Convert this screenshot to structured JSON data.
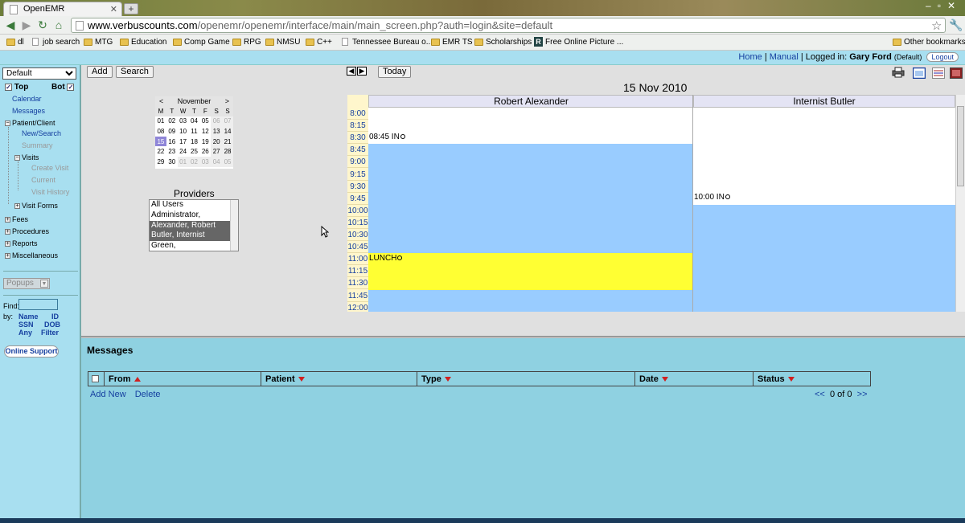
{
  "browser": {
    "tab_title": "OpenEMR",
    "url_host": "www.verbuscounts.com",
    "url_path": "/openemr/openemr/interface/main/main_screen.php?auth=login&site=default",
    "bookmarks": [
      {
        "label": "dl",
        "icon": "folder"
      },
      {
        "label": "job search",
        "icon": "page"
      },
      {
        "label": "MTG",
        "icon": "folder"
      },
      {
        "label": "Education",
        "icon": "folder"
      },
      {
        "label": "Comp Game",
        "icon": "folder"
      },
      {
        "label": "RPG",
        "icon": "folder"
      },
      {
        "label": "NMSU",
        "icon": "folder"
      },
      {
        "label": "C++",
        "icon": "folder"
      },
      {
        "label": "Tennessee Bureau o...",
        "icon": "page"
      },
      {
        "label": "EMR TS",
        "icon": "folder"
      },
      {
        "label": "Scholarships",
        "icon": "folder"
      },
      {
        "label": "Free Online Picture ...",
        "icon": "r"
      }
    ],
    "other_bookmarks": "Other bookmarks"
  },
  "header": {
    "home": "Home",
    "sep1": "|",
    "manual": "Manual",
    "sep2": "|",
    "logged_in_label": "Logged in:",
    "user": "Gary Ford",
    "user_group": "(Default)",
    "logout": "Logout"
  },
  "leftnav": {
    "facility_select": "Default",
    "top_label": "Top",
    "bot_label": "Bot",
    "calendar": "Calendar",
    "messages": "Messages",
    "patient_client": "Patient/Client",
    "new_search": "New/Search",
    "summary": "Summary",
    "visits": "Visits",
    "create_visit": "Create Visit",
    "current": "Current",
    "visit_history": "Visit History",
    "visit_forms": "Visit Forms",
    "fees": "Fees",
    "procedures": "Procedures",
    "reports": "Reports",
    "miscellaneous": "Miscellaneous",
    "popups": "Popups",
    "find_label": "Find:",
    "by_label": "by:",
    "find_opts": {
      "name": "Name",
      "id": "ID",
      "ssn": "SSN",
      "dob": "DOB",
      "any": "Any",
      "filter": "Filter"
    },
    "online_support": "Online Support"
  },
  "calendar": {
    "add": "Add",
    "search": "Search",
    "today": "Today",
    "date_title": "15 Nov 2010",
    "mini": {
      "prev": "<",
      "month": "November",
      "next": ">",
      "dow": [
        "M",
        "T",
        "W",
        "T",
        "F",
        "S",
        "S"
      ],
      "weeks": [
        [
          "01",
          "02",
          "03",
          "04",
          "05",
          "06",
          "07"
        ],
        [
          "08",
          "09",
          "10",
          "11",
          "12",
          "13",
          "14"
        ],
        [
          "15",
          "16",
          "17",
          "18",
          "19",
          "20",
          "21"
        ],
        [
          "22",
          "23",
          "24",
          "25",
          "26",
          "27",
          "28"
        ],
        [
          "29",
          "30",
          "01",
          "02",
          "03",
          "04",
          "05"
        ]
      ],
      "today": "15"
    },
    "providers_title": "Providers",
    "providers": [
      "All Users",
      "Administrator,",
      "Alexander, Robert",
      "Butler, Internist",
      "Green,"
    ],
    "providers_selected": [
      2,
      3
    ],
    "columns": [
      "Robert Alexander",
      "Internist Butler"
    ],
    "times": [
      "8:00",
      "8:15",
      "8:30",
      "8:45",
      "9:00",
      "9:15",
      "9:30",
      "9:45",
      "10:00",
      "10:15",
      "10:30",
      "10:45",
      "11:00",
      "11:15",
      "11:30",
      "11:45",
      "12:00"
    ],
    "events": {
      "a_in": "08:45 IN",
      "a_lunch": "LUNCH",
      "b_in": "10:00 IN"
    },
    "colors": {
      "available": "#99ccff",
      "lunch": "#ffff33",
      "free": "#ffffff"
    }
  },
  "messages": {
    "title": "Messages",
    "columns": [
      "From",
      "Patient",
      "Type",
      "Date",
      "Status"
    ],
    "add_new": "Add New",
    "delete": "Delete",
    "prev": "<<",
    "count": "0 of 0",
    "next": ">>"
  }
}
